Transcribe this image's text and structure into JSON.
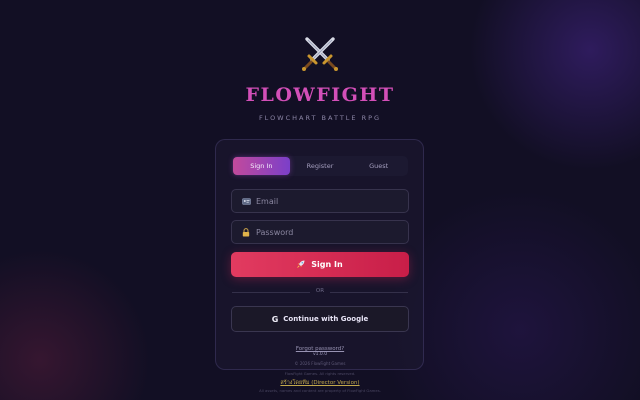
{
  "app": {
    "logo_icon": "crossed-swords-icon",
    "title": "FLOWFIGHT",
    "subtitle": "FLOWCHART BATTLE RPG"
  },
  "tabs": [
    {
      "label": "Sign In",
      "active": true
    },
    {
      "label": "Register",
      "active": false
    },
    {
      "label": "Guest",
      "active": false
    }
  ],
  "form": {
    "email": {
      "icon": "id-card-icon",
      "placeholder": "Email",
      "value": ""
    },
    "password": {
      "icon": "lock-icon",
      "placeholder": "Password",
      "value": ""
    },
    "signin_button": {
      "icon": "rocket-icon",
      "label": "Sign In"
    },
    "divider_label": "OR",
    "google_button": {
      "icon": "google-g-icon",
      "glyph": "G",
      "label": "Continue with Google"
    }
  },
  "footer": {
    "forgot_link": "Forgot password?",
    "version": "v1.0.0",
    "copyright": "© 2026 FlowFight Games",
    "rights": "FlowFight Games. All rights reserved.",
    "credit_link": "สร้างโดยทีม (Director Version)",
    "footnote": "All assets, names and content are property of FlowFight Games."
  },
  "colors": {
    "background": "#120f24",
    "brand": "#d34fb8",
    "accent_tab_from": "#c24a9c",
    "accent_tab_to": "#7b3fc9",
    "signin_from": "#e23b60",
    "signin_to": "#c81e48"
  }
}
